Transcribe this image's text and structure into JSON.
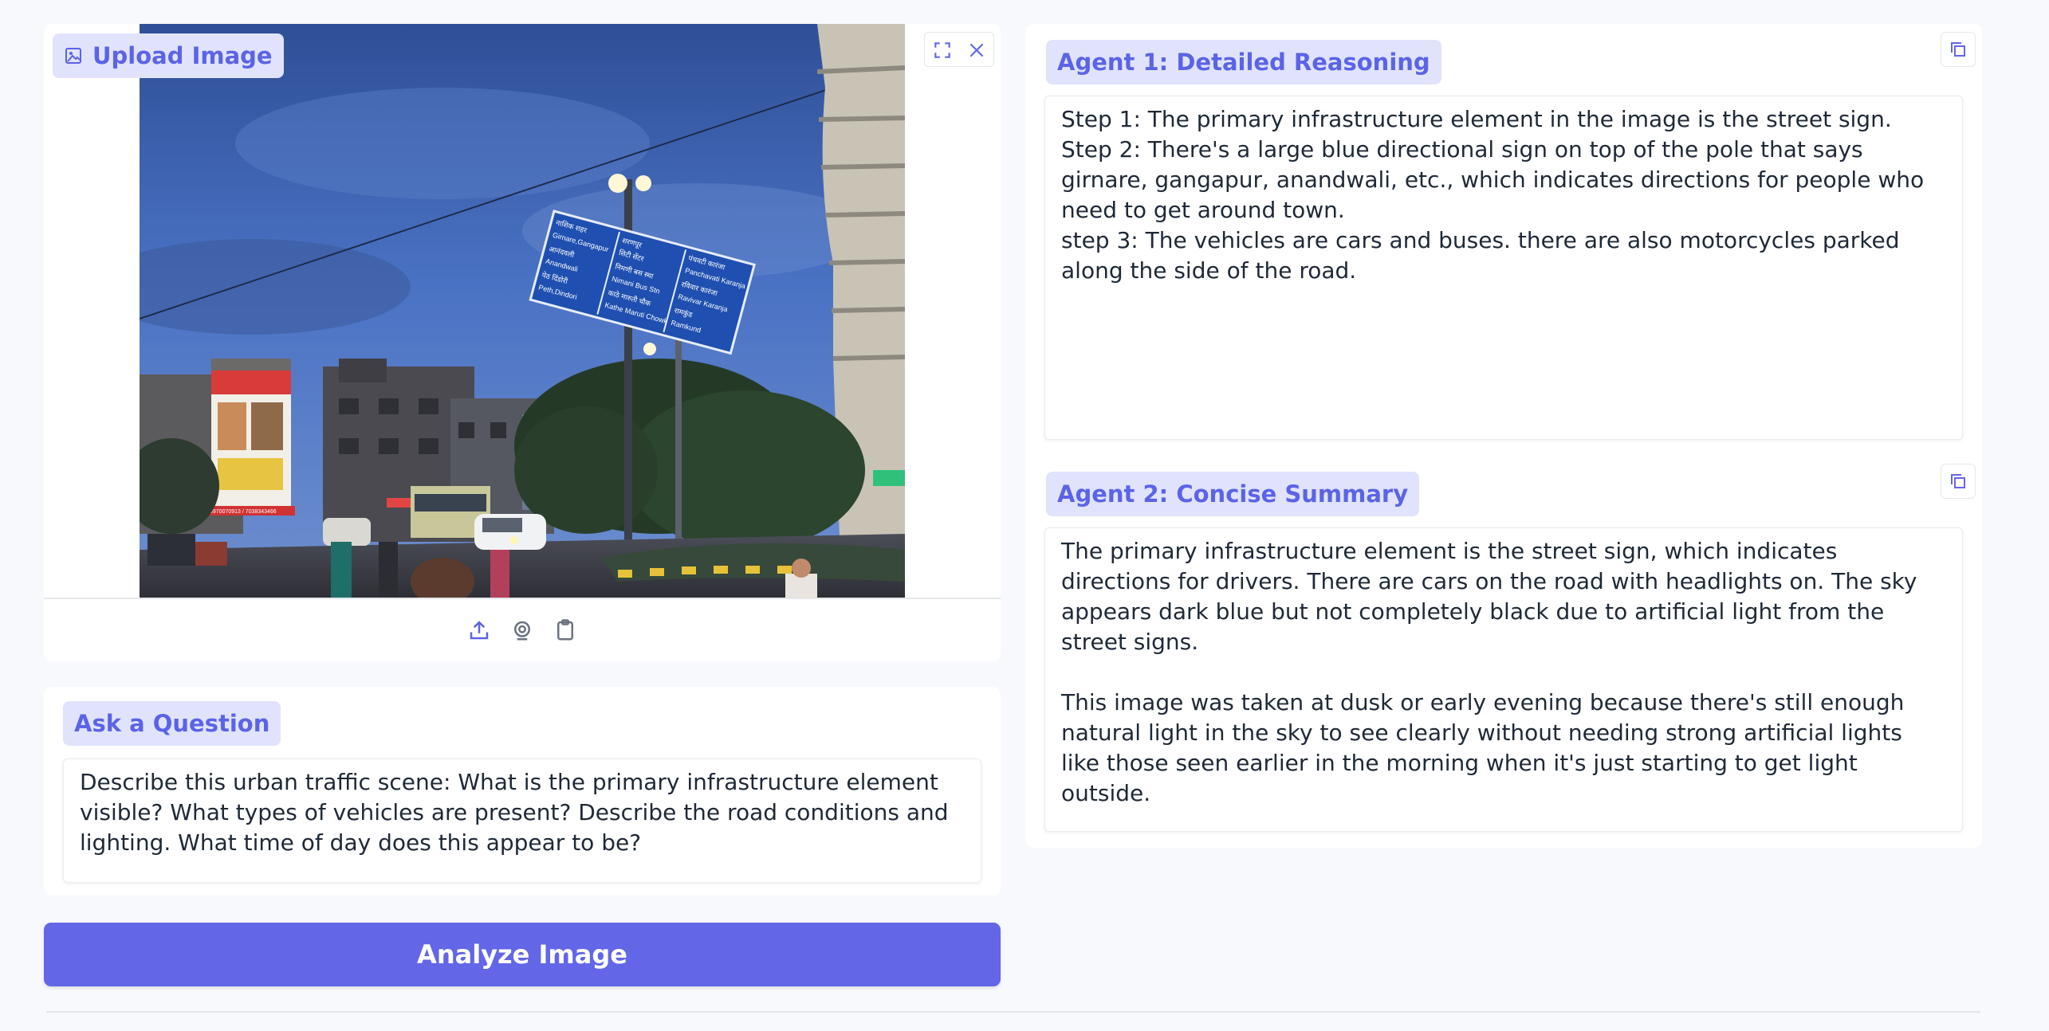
{
  "upload_section": {
    "label": "Upload Image",
    "tools": {
      "upload_icon": "upload-icon",
      "webcam_icon": "webcam-icon",
      "clipboard_icon": "clipboard-icon"
    }
  },
  "photo_signs": {
    "left_sign": [
      "नाशिक शहर",
      "Girnare,Gangapur",
      "आनंदवली",
      "Anandwali",
      "पेठ दिंडोरी",
      "Peth,Dindori"
    ],
    "middle_sign": [
      "शरणपूर",
      "सिटी सेंटर",
      "निमणी बस स्था",
      "Nimani Bus Stn",
      "काठे मारुती चौक",
      "Kathe Maruti Chowk"
    ],
    "right_sign": [
      "पंचवटी कारंजा",
      "Panchavati Karanja",
      "रविवार कारंजा",
      "Ravivar Karanja",
      "रामकुंड",
      "Ramkund"
    ],
    "billboard_phone": "9970070913 / 7038343466"
  },
  "question_section": {
    "label": "Ask a Question",
    "text": "Describe this urban traffic scene: What is the primary infrastructure element visible? What types of vehicles are present? Describe the road conditions and lighting. What time of day does this appear to be?"
  },
  "analyze_button": {
    "label": "Analyze Image"
  },
  "agent1": {
    "label": "Agent 1: Detailed Reasoning",
    "text": "Step 1: The primary infrastructure element in the image is the street sign.\nStep 2: There's a large blue directional sign on top of the pole that says girnare, gangapur, anandwali, etc., which indicates directions for people who need to get around town.\nstep 3: The vehicles are cars and buses. there are also motorcycles parked along the side of the road."
  },
  "agent2": {
    "label": "Agent 2: Concise Summary",
    "text": "The primary infrastructure element is the street sign, which indicates directions for drivers. There are cars on the road with headlights on. The sky appears dark blue but not completely black due to artificial light from the street signs.\n\nThis image was taken at dusk or early evening because there's still enough natural light in the sky to see clearly without needing strong artificial lights like those seen earlier in the morning when it's just starting to get light outside."
  },
  "colors": {
    "accent": "#6366e7",
    "chip_bg": "#e0e3fb",
    "chip_text": "#5b63e6",
    "page_bg": "#f8f9fc"
  }
}
